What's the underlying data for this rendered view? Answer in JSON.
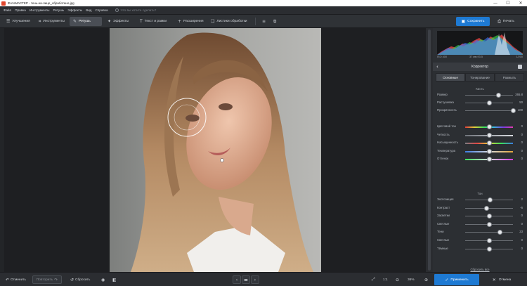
{
  "window": {
    "title": "ФотоМАСТЕР - тень-на-лице_обработано.jpg",
    "minimize": "—",
    "maximize": "☐",
    "close": "✕"
  },
  "menu": {
    "items": [
      "Файл",
      "Правка",
      "Инструменты",
      "Ретушь",
      "Эффекты",
      "Вид",
      "Справка"
    ],
    "search_placeholder": "Что вы хотите сделать?"
  },
  "toolbar": {
    "enhance": "Улучшения",
    "tools": "Инструменты",
    "retouch": "Ретушь",
    "effects": "Эффекты",
    "text_frames": "Текст и рамки",
    "extras": "Расширения",
    "exposure": "Листики обработки",
    "save": "Сохранить",
    "print": "Печать"
  },
  "histogram": {
    "left": "ISO 400",
    "center": "37 мм f/3.5",
    "right": "1/200"
  },
  "panel": {
    "title": "Корректор",
    "tabs": [
      "Основные",
      "Тонирование",
      "Размыть"
    ],
    "brush_title": "Кисть",
    "brush": [
      {
        "label": "Размер",
        "value": "265.8",
        "pos": 0.7
      },
      {
        "label": "Растушевка",
        "value": "50",
        "pos": 0.5
      },
      {
        "label": "Прозрачность",
        "value": "100",
        "pos": 1.0
      }
    ],
    "color": [
      {
        "label": "Цветовой тон",
        "value": "0",
        "pos": 0.5
      },
      {
        "label": "Четкость",
        "value": "0",
        "pos": 0.5
      },
      {
        "label": "Насыщенность",
        "value": "0",
        "pos": 0.5
      },
      {
        "label": "Температура",
        "value": "0",
        "pos": 0.5
      },
      {
        "label": "Оттенок",
        "value": "0",
        "pos": 0.5
      }
    ],
    "tone_title": "Тон",
    "tone": [
      {
        "label": "Экспозиция",
        "value": "2",
        "pos": 0.52
      },
      {
        "label": "Контраст",
        "value": "-6",
        "pos": 0.45
      },
      {
        "label": "Засветки",
        "value": "0",
        "pos": 0.5
      },
      {
        "label": "Светлые",
        "value": "0",
        "pos": 0.5
      },
      {
        "label": "Тени",
        "value": "23",
        "pos": 0.73
      },
      {
        "label": "Светлые",
        "value": "0",
        "pos": 0.5
      },
      {
        "label": "Тёмные",
        "value": "0",
        "pos": 0.5
      }
    ],
    "reset_all": "Сбросить все"
  },
  "bottom": {
    "undo": "Отменить",
    "redo": "Повторить",
    "reset": "Сбросить",
    "zoom_ratio": "1:1",
    "zoom": "36%",
    "apply": "Применить",
    "cancel": "Отмена"
  }
}
